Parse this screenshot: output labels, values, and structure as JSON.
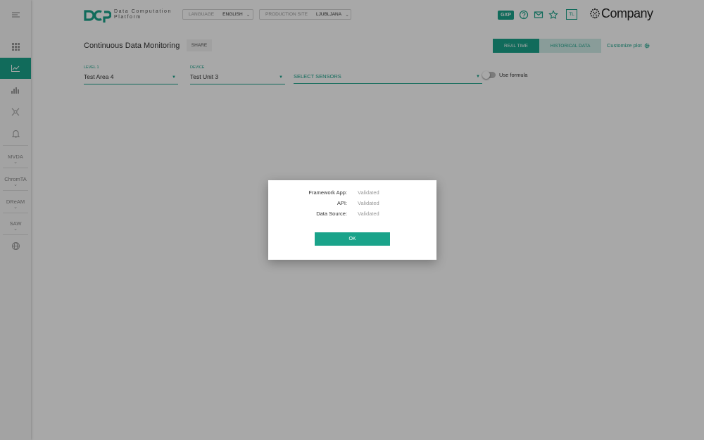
{
  "colors": {
    "accent": "#1aa38a",
    "accent_light": "#d1ede8",
    "overlay": "rgba(0,0,0,0.34)"
  },
  "header": {
    "logo_line1": "Data Computation",
    "logo_line2": "Platform",
    "language_label": "LANGUAGE",
    "language_value": "ENGLISH",
    "site_label": "PRODUCTION SITE",
    "site_value": "LJUBLJANA",
    "gxp_badge": "GXP",
    "avatar_initials": "TL",
    "company": "Company",
    "icons": [
      "help-icon",
      "mail-icon",
      "star-icon"
    ]
  },
  "sidebar": {
    "items": [
      {
        "name": "menu-icon"
      },
      {
        "name": "grid-icon"
      },
      {
        "name": "line-chart-icon",
        "active": true
      },
      {
        "name": "bar-chart-icon"
      },
      {
        "name": "network-icon"
      },
      {
        "name": "bell-icon"
      }
    ],
    "groups": [
      "MVDA",
      "ChromTA",
      "DReAM",
      "SAW"
    ],
    "footer_icon": "globe-icon"
  },
  "page": {
    "title": "Continuous Data Monitoring",
    "share_label": "SHARE",
    "realtime_label": "REAL TIME",
    "historical_label": "HISTORICAL DATA",
    "customize_label": "Customize plot"
  },
  "filters": {
    "level_label": "LEVEL 1",
    "level_value": "Test Area 4",
    "device_label": "DEVICE",
    "device_value": "Test Unit 3",
    "sensors_placeholder": "SELECT SENSORS",
    "use_formula_label": "Use formula",
    "use_formula_on": false
  },
  "modal": {
    "rows": [
      {
        "key": "Framework App:",
        "value": "Validated"
      },
      {
        "key": "API:",
        "value": "Validated"
      },
      {
        "key": "Data Source:",
        "value": "Validated"
      }
    ],
    "ok_label": "OK"
  }
}
